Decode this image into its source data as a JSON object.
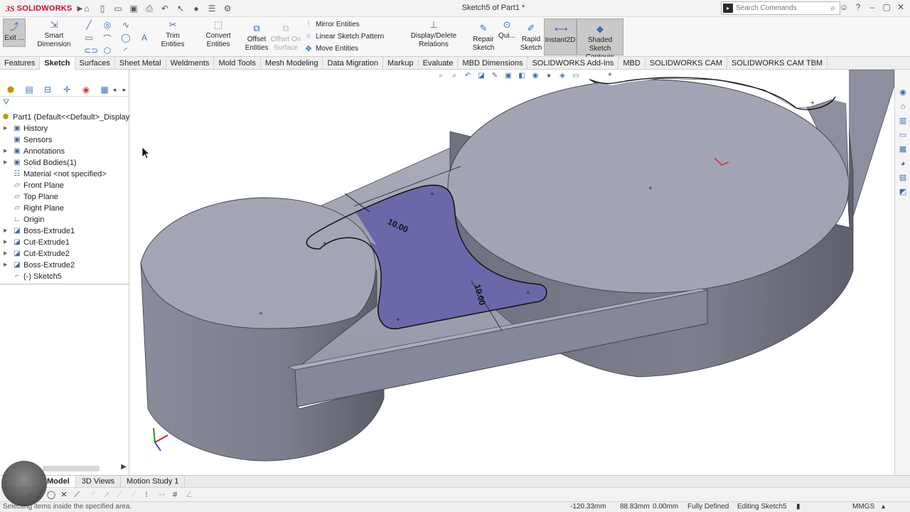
{
  "app": {
    "logo_ds": "3S",
    "logo_text": "SOLIDWORKS",
    "doc_title": "Sketch5 of Part1 *",
    "search_placeholder": "Search Commands"
  },
  "ribbon": {
    "exit_label": "Exit ...",
    "smart_dimension": "Smart Dimension",
    "trim_entities": "Trim Entities",
    "convert_entities": "Convert Entities",
    "offset_entities_1": "Offset",
    "offset_entities_2": "Entities",
    "offset_surface_1": "Offset On",
    "offset_surface_2": "Surface",
    "mirror_entities": "Mirror Entities",
    "linear_sketch_pattern": "Linear Sketch Pattern",
    "move_entities": "Move Entities",
    "display_delete_relations": "Display/Delete Relations",
    "repair_sketch_1": "Repair",
    "repair_sketch_2": "Sketch",
    "quick_snaps": "Qui...",
    "rapid_sketch_1": "Rapid",
    "rapid_sketch_2": "Sketch",
    "instant2d": "Instant2D",
    "shaded_contours_1": "Shaded Sketch",
    "shaded_contours_2": "Contours"
  },
  "tabs": [
    "Features",
    "Sketch",
    "Surfaces",
    "Sheet Metal",
    "Weldments",
    "Mold Tools",
    "Mesh Modeling",
    "Data Migration",
    "Markup",
    "Evaluate",
    "MBD Dimensions",
    "SOLIDWORKS Add-Ins",
    "MBD",
    "SOLIDWORKS CAM",
    "SOLIDWORKS CAM TBM"
  ],
  "active_tab": "Sketch",
  "tree": {
    "root": "Part1  (Default<<Default>_Display S",
    "items": [
      {
        "label": "History",
        "icon": "history-icon",
        "expandable": true
      },
      {
        "label": "Sensors",
        "icon": "sensors-icon",
        "expandable": false
      },
      {
        "label": "Annotations",
        "icon": "annotations-icon",
        "expandable": true
      },
      {
        "label": "Solid Bodies(1)",
        "icon": "solid-bodies-icon",
        "expandable": true
      },
      {
        "label": "Material <not specified>",
        "icon": "material-icon",
        "expandable": false
      },
      {
        "label": "Front Plane",
        "icon": "plane-icon",
        "expandable": false
      },
      {
        "label": "Top Plane",
        "icon": "plane-icon",
        "expandable": false
      },
      {
        "label": "Right Plane",
        "icon": "plane-icon",
        "expandable": false
      },
      {
        "label": "Origin",
        "icon": "origin-icon",
        "expandable": false
      },
      {
        "label": "Boss-Extrude1",
        "icon": "extrude-icon",
        "expandable": true
      },
      {
        "label": "Cut-Extrude1",
        "icon": "extrude-icon",
        "expandable": true
      },
      {
        "label": "Cut-Extrude2",
        "icon": "extrude-icon",
        "expandable": true
      },
      {
        "label": "Boss-Extrude2",
        "icon": "extrude-icon",
        "expandable": true
      },
      {
        "label": "(-) Sketch5",
        "icon": "sketch-icon",
        "expandable": false
      }
    ]
  },
  "viewport": {
    "dim_a": "10.00",
    "dim_b": "10.00"
  },
  "bottom_tabs": [
    "Model",
    "3D Views",
    "Motion Study 1"
  ],
  "status": {
    "message": "Selecting items inside the specified area.",
    "x": "-120.33mm",
    "y": "88.83mm",
    "z": "0.00mm",
    "state": "Fully Defined",
    "editing": "Editing Sketch5",
    "units": "MMGS"
  },
  "colors": {
    "body": "#9d9faf",
    "body_dark": "#5c5d68",
    "sketch_fill": "#6a68a8",
    "accent": "#3a6fb0",
    "brand": "#c8102e"
  }
}
